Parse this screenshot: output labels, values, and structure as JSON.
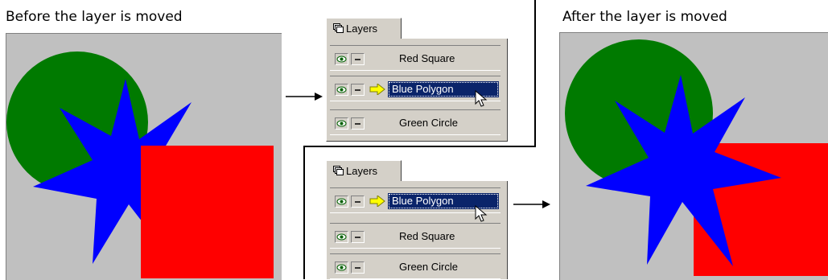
{
  "captions": {
    "before": "Before the layer is moved",
    "after": "After the layer is moved"
  },
  "colors": {
    "canvas": "#c0c0c0",
    "green_circle": "#007a00",
    "blue_polygon": "#0000ff",
    "red_square": "#ff0000",
    "selection": "#0a246a"
  },
  "panels": {
    "top": {
      "tab_label": "Layers",
      "layers": [
        {
          "name": "Red Square",
          "selected": false
        },
        {
          "name": "Blue Polygon",
          "selected": true
        },
        {
          "name": "Green Circle",
          "selected": false
        }
      ]
    },
    "bottom": {
      "tab_label": "Layers",
      "layers": [
        {
          "name": "Blue Polygon",
          "selected": true
        },
        {
          "name": "Red Square",
          "selected": false
        },
        {
          "name": "Green Circle",
          "selected": false
        }
      ]
    }
  },
  "icons": {
    "tab": "layers-icon",
    "visibility": "eye-icon",
    "lock": "lock-toggle-icon",
    "current": "current-layer-arrow-icon",
    "pointer": "mouse-pointer-icon"
  }
}
